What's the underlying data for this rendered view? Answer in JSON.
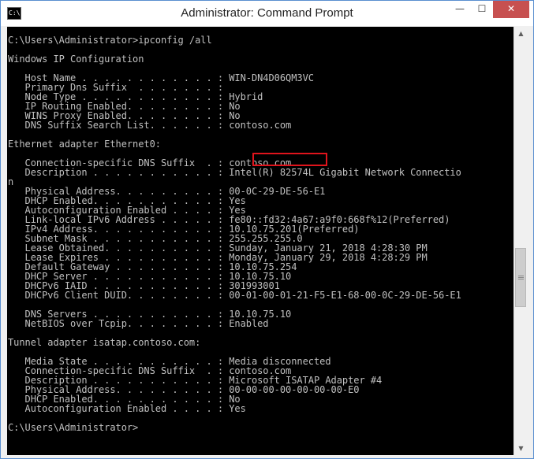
{
  "window": {
    "title": "Administrator: Command Prompt",
    "minimize_glyph": "—",
    "maximize_glyph": "☐",
    "close_glyph": "✕",
    "app_icon_label": "C:\\"
  },
  "console": {
    "lines": [
      "C:\\Users\\Administrator>ipconfig /all",
      "",
      "Windows IP Configuration",
      "",
      "   Host Name . . . . . . . . . . . . : WIN-DN4D06QM3VC",
      "   Primary Dns Suffix  . . . . . . . :",
      "   Node Type . . . . . . . . . . . . : Hybrid",
      "   IP Routing Enabled. . . . . . . . : No",
      "   WINS Proxy Enabled. . . . . . . . : No",
      "   DNS Suffix Search List. . . . . . : contoso.com",
      "",
      "Ethernet adapter Ethernet0:",
      "",
      "   Connection-specific DNS Suffix  . : contoso.com",
      "   Description . . . . . . . . . . . : Intel(R) 82574L Gigabit Network Connectio",
      "n",
      "   Physical Address. . . . . . . . . : 00-0C-29-DE-56-E1",
      "   DHCP Enabled. . . . . . . . . . . : Yes",
      "   Autoconfiguration Enabled . . . . : Yes",
      "   Link-local IPv6 Address . . . . . : fe80::fd32:4a67:a9f0:668f%12(Preferred)",
      "   IPv4 Address. . . . . . . . . . . : 10.10.75.201(Preferred)",
      "   Subnet Mask . . . . . . . . . . . : 255.255.255.0",
      "   Lease Obtained. . . . . . . . . . : Sunday, January 21, 2018 4:28:30 PM",
      "   Lease Expires . . . . . . . . . . : Monday, January 29, 2018 4:28:29 PM",
      "   Default Gateway . . . . . . . . . : 10.10.75.254",
      "   DHCP Server . . . . . . . . . . . : 10.10.75.10",
      "   DHCPv6 IAID . . . . . . . . . . . : 301993001",
      "   DHCPv6 Client DUID. . . . . . . . : 00-01-00-01-21-F5-E1-68-00-0C-29-DE-56-E1",
      "",
      "   DNS Servers . . . . . . . . . . . : 10.10.75.10",
      "   NetBIOS over Tcpip. . . . . . . . : Enabled",
      "",
      "Tunnel adapter isatap.contoso.com:",
      "",
      "   Media State . . . . . . . . . . . : Media disconnected",
      "   Connection-specific DNS Suffix  . : contoso.com",
      "   Description . . . . . . . . . . . : Microsoft ISATAP Adapter #4",
      "   Physical Address. . . . . . . . . : 00-00-00-00-00-00-00-E0",
      "   DHCP Enabled. . . . . . . . . . . : No",
      "   Autoconfiguration Enabled . . . . : Yes",
      "",
      "C:\\Users\\Administrator>"
    ]
  },
  "scrollbar": {
    "up_glyph": "▲",
    "down_glyph": "▼"
  },
  "colors": {
    "console_bg": "#000000",
    "console_fg": "#c0c0c0",
    "highlight_border": "#e0141c",
    "close_button": "#c75050"
  }
}
